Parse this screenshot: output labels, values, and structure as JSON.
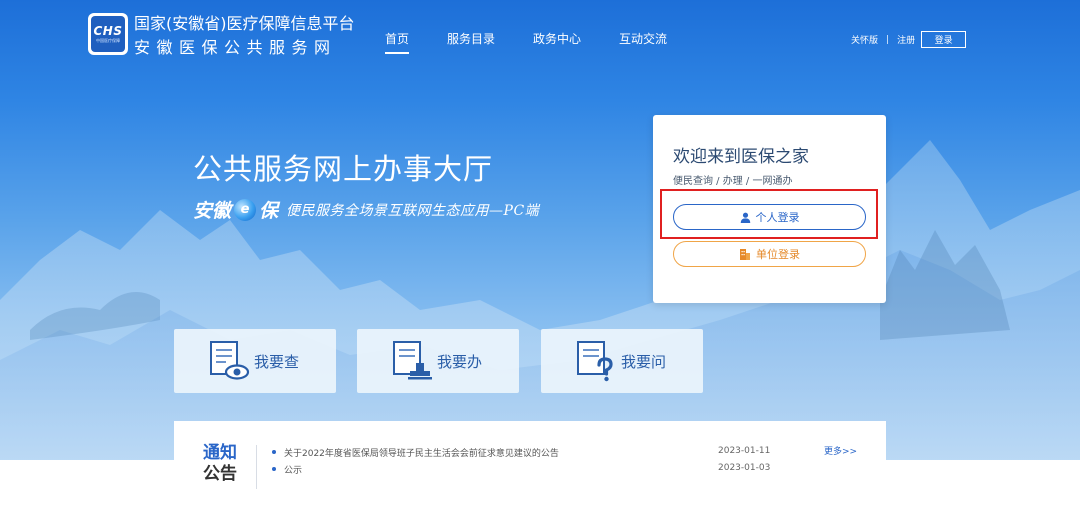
{
  "header": {
    "logo_text": "CHS",
    "logo_subtext": "中国医疗保障",
    "title_line1": "国家(安徽省)医疗保障信息平台",
    "title_line2": "安徽医保公共服务网"
  },
  "nav": {
    "items": [
      {
        "label": "首页",
        "active": true
      },
      {
        "label": "服务目录",
        "active": false
      },
      {
        "label": "政务中心",
        "active": false
      },
      {
        "label": "互动交流",
        "active": false
      }
    ]
  },
  "top_right": {
    "care_mode": "关怀版",
    "separator": "|",
    "register": "注册",
    "login": "登录"
  },
  "hero": {
    "title": "公共服务网上办事大厅",
    "brand_part1": "安徽",
    "brand_e": "e",
    "brand_part2": "保",
    "slogan": "便民服务全场景互联网生态应用—PC端"
  },
  "login_card": {
    "title": "欢迎来到医保之家",
    "subtitle": "便民查询 / 办理 / 一网通办",
    "personal_login": "个人登录",
    "unit_login": "单位登录"
  },
  "tiles": [
    {
      "label": "我要查",
      "icon": "document-eye-icon"
    },
    {
      "label": "我要办",
      "icon": "document-stamp-icon"
    },
    {
      "label": "我要问",
      "icon": "document-question-icon"
    }
  ],
  "notice": {
    "label_line1": "通知",
    "label_line2": "公告",
    "items": [
      {
        "title": "关于2022年度省医保局领导班子民主生活会会前征求意见建议的公告",
        "date": "2023-01-11"
      },
      {
        "title": "公示",
        "date": "2023-01-03"
      }
    ],
    "more": "更多>>"
  },
  "colors": {
    "primary_blue": "#2a66c8",
    "accent_orange": "#f0a548",
    "highlight_red": "#e02020"
  }
}
